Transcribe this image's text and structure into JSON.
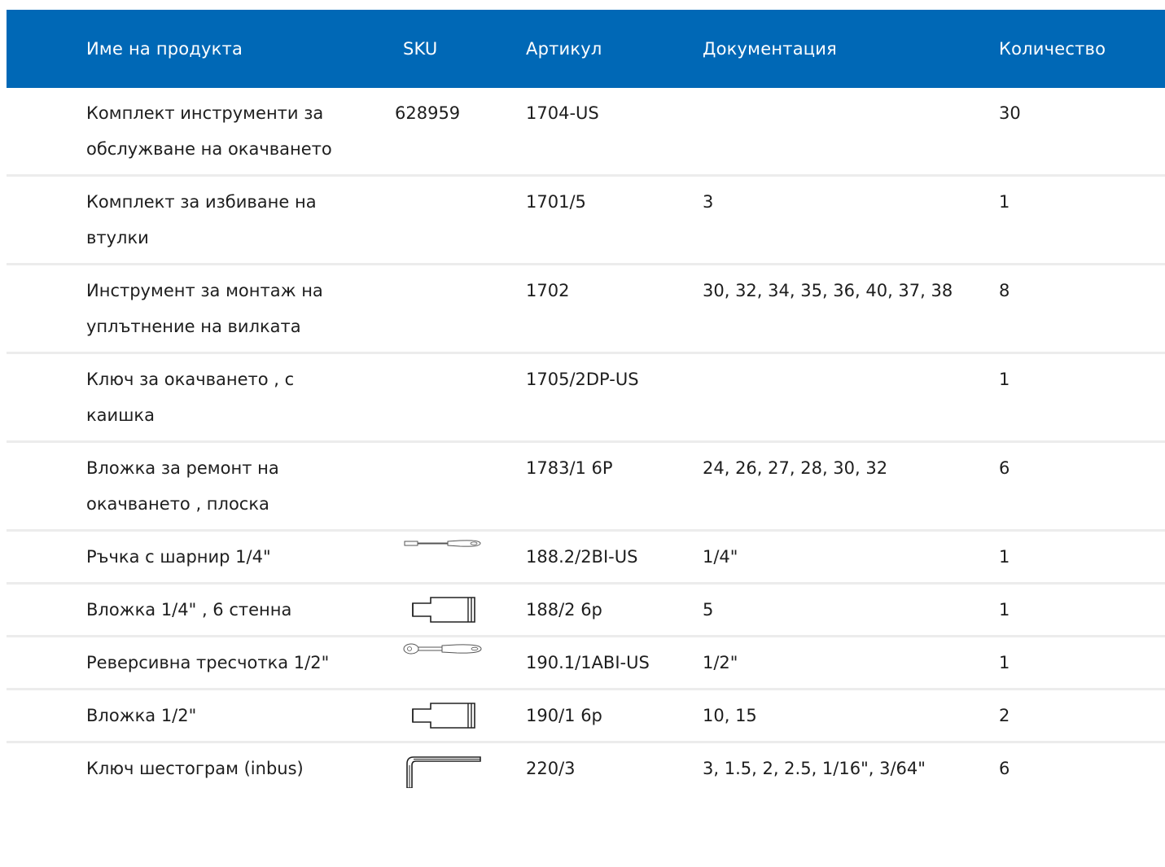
{
  "headers": {
    "name": "Име на продукта",
    "sku": "SKU",
    "article": "Артикул",
    "docs": "Документация",
    "qty": "Количество"
  },
  "colors": {
    "header_bg": "#0068b6",
    "header_text": "#ffffff",
    "row_divider": "#ececec"
  },
  "rows": [
    {
      "name": "Комплект инструменти за обслужване на окачването",
      "sku": "628959",
      "article": "1704-US",
      "docs": "",
      "qty": "30",
      "icon": ""
    },
    {
      "name": "Комплект за избиване на втулки",
      "sku": "",
      "article": "1701/5",
      "docs": "3",
      "qty": "1",
      "icon": ""
    },
    {
      "name": "Инструмент за монтаж на уплътнение на вилката",
      "sku": "",
      "article": "1702",
      "docs": "30, 32, 34, 35, 36, 40, 37, 38",
      "qty": "8",
      "icon": ""
    },
    {
      "name": "Ключ за окачването , с каишка",
      "sku": "",
      "article": "1705/2DP-US",
      "docs": "",
      "qty": "1",
      "icon": ""
    },
    {
      "name": "Вложка за ремонт на окачването , плоска",
      "sku": "",
      "article": "1783/1 6P",
      "docs": "24, 26, 27, 28, 30, 32",
      "qty": "6",
      "icon": ""
    },
    {
      "name": "Ръчка с шарнир 1/4\"",
      "sku": "",
      "article": "188.2/2BI-US",
      "docs": "1/4\"",
      "qty": "1",
      "icon": "hinged-handle-icon"
    },
    {
      "name": "Вложка 1/4\" , 6 стенна",
      "sku": "",
      "article": "188/2 6p",
      "docs": "5",
      "qty": "1",
      "icon": "socket-icon"
    },
    {
      "name": "Реверсивна тресчотка 1/2\"",
      "sku": "",
      "article": "190.1/1ABI-US",
      "docs": "1/2\"",
      "qty": "1",
      "icon": "ratchet-icon"
    },
    {
      "name": "Вложка 1/2\"",
      "sku": "",
      "article": "190/1 6p",
      "docs": "10, 15",
      "qty": "2",
      "icon": "socket-icon"
    },
    {
      "name": "Ключ шестограм (inbus)",
      "sku": "",
      "article": "220/3",
      "docs": "3, 1.5, 2, 2.5, 1/16\", 3/64\"",
      "qty": "6",
      "icon": "hex-key-icon"
    }
  ]
}
